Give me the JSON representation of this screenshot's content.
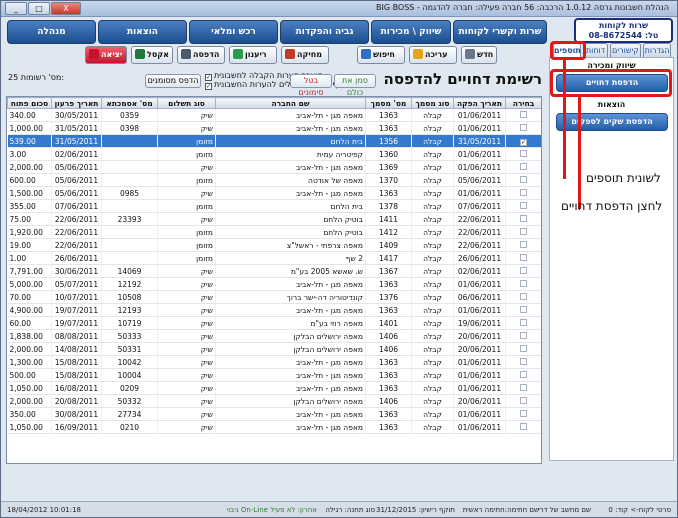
{
  "window": {
    "title": "BIG BOSS - הנהלת חשבונות גרסה 1.0.12 הרכבה: 56 חברה פעילה: חברה להדגמה"
  },
  "window_buttons": {
    "minimize": "_",
    "maximize": "□",
    "close": "X"
  },
  "nav": [
    "שרות וקשרי לקוחות",
    "שיווק \\ מכירות",
    "גביה והפקדות",
    "רכש ומלאי",
    "הוצאות",
    "מנהלה"
  ],
  "contact": {
    "line1": "שרות לקוחות",
    "line2": "טל: 08-8672544"
  },
  "toolbar": [
    {
      "label": "חדש",
      "color": "#6a7788"
    },
    {
      "label": "עריכה",
      "color": "#e4a51b"
    },
    {
      "label": "חיפוש",
      "color": "#2f6fc8"
    },
    {
      "label": "מחיקה",
      "color": "#c0392b"
    },
    {
      "label": "ריענון",
      "color": "#2a9d4a"
    },
    {
      "label": "הדפסה",
      "color": "#4a5b70"
    },
    {
      "label": "אקסל",
      "color": "#1f7a3d"
    },
    {
      "label": "יציאה",
      "color": "#c8122b"
    }
  ],
  "tabs": [
    "הגדרות",
    "קישורים",
    "דוחות",
    "תוספים"
  ],
  "page": {
    "title": "רשימת דחויים להדפסה",
    "records_label": "מס' רשומות:",
    "records_count": "25"
  },
  "options": {
    "opt1": "הועבר הערות הקבלה לחשבונית",
    "opt2": "הוסף שרותים פעילים להערות החשבונית"
  },
  "actions": {
    "print_selected": "הדפס מסומנים",
    "clear_marks": "בטל סימונים",
    "mark_all": "סמן את כולם"
  },
  "columns": [
    "בחירה",
    "תאריך הפקה",
    "סוג מסמך",
    "מס' מסמך",
    "שם החברה",
    "סוג תשלום",
    "מס' אסמכתא",
    "תאריך פרעון",
    "סכום פתוח"
  ],
  "rows": [
    {
      "date": "01/06/2011",
      "type": "קבלה",
      "num": "1363",
      "company": "מאפה מגן - תל-אביב",
      "pay": "שיק",
      "ref": "0359",
      "due": "30/05/2011",
      "amount": "340.00",
      "sel": false
    },
    {
      "date": "01/06/2011",
      "type": "קבלה",
      "num": "1363",
      "company": "מאפה מגן - תל-אביב",
      "pay": "שיק",
      "ref": "0398",
      "due": "31/05/2011",
      "amount": "1,000.00",
      "sel": false
    },
    {
      "date": "31/05/2011",
      "type": "קבלה",
      "num": "1356",
      "company": "בית הלחם",
      "pay": "מזומן",
      "ref": "",
      "due": "31/05/2011",
      "amount": "539.00",
      "sel": true
    },
    {
      "date": "01/06/2011",
      "type": "קבלה",
      "num": "1360",
      "company": "קפיטריה עמית",
      "pay": "מזומן",
      "ref": "",
      "due": "02/06/2011",
      "amount": "3.00",
      "sel": false
    },
    {
      "date": "01/06/2011",
      "type": "קבלה",
      "num": "1369",
      "company": "מאפה מגן - תל-אביב",
      "pay": "שיק",
      "ref": "",
      "due": "05/06/2011",
      "amount": "2,000.00",
      "sel": false
    },
    {
      "date": "05/06/2011",
      "type": "קבלה",
      "num": "1370",
      "company": "מאפה של אודטה",
      "pay": "מזומן",
      "ref": "",
      "due": "05/06/2011",
      "amount": "600.00",
      "sel": false
    },
    {
      "date": "01/06/2011",
      "type": "קבלה",
      "num": "1363",
      "company": "מאפה מגן - תל-אביב",
      "pay": "שיק",
      "ref": "0985",
      "due": "05/06/2011",
      "amount": "1,500.00",
      "sel": false
    },
    {
      "date": "07/06/2011",
      "type": "קבלה",
      "num": "1378",
      "company": "בית הלחם",
      "pay": "מזומן",
      "ref": "",
      "due": "07/06/2011",
      "amount": "355.00",
      "sel": false
    },
    {
      "date": "22/06/2011",
      "type": "קבלה",
      "num": "1411",
      "company": "בוטיק הלחם",
      "pay": "שיק",
      "ref": "23393",
      "due": "22/06/2011",
      "amount": "75.00",
      "sel": false
    },
    {
      "date": "22/06/2011",
      "type": "קבלה",
      "num": "1412",
      "company": "בוטיק הלחם",
      "pay": "מזומן",
      "ref": "",
      "due": "22/06/2011",
      "amount": "1,920.00",
      "sel": false
    },
    {
      "date": "22/06/2011",
      "type": "קבלה",
      "num": "1409",
      "company": "מאפה צרפתי - ראשל\"צ",
      "pay": "מזומן",
      "ref": "",
      "due": "22/06/2011",
      "amount": "19.00",
      "sel": false
    },
    {
      "date": "26/06/2011",
      "type": "קבלה",
      "num": "1417",
      "company": "2 שף",
      "pay": "מזומן",
      "ref": "",
      "due": "26/06/2011",
      "amount": "1.00",
      "sel": false
    },
    {
      "date": "02/06/2011",
      "type": "קבלה",
      "num": "1367",
      "company": "ש. שאשא 2005 בע\"מ",
      "pay": "שיק",
      "ref": "14069",
      "due": "30/06/2011",
      "amount": "7,791.00",
      "sel": false
    },
    {
      "date": "01/06/2011",
      "type": "קבלה",
      "num": "1363",
      "company": "מאפה מגן - תל-אביב",
      "pay": "שיק",
      "ref": "12192",
      "due": "05/07/2011",
      "amount": "5,000.00",
      "sel": false
    },
    {
      "date": "06/06/2011",
      "type": "קבלה",
      "num": "1376",
      "company": "קונדיטוריה דה-ישר ברוך",
      "pay": "שיק",
      "ref": "10508",
      "due": "10/07/2011",
      "amount": "70.00",
      "sel": false
    },
    {
      "date": "01/06/2011",
      "type": "קבלה",
      "num": "1363",
      "company": "מאפה מגן - תל-אביב",
      "pay": "שיק",
      "ref": "12193",
      "due": "19/07/2011",
      "amount": "4,900.00",
      "sel": false
    },
    {
      "date": "19/06/2011",
      "type": "קבלה",
      "num": "1401",
      "company": "מאפה רוזי בע\"מ",
      "pay": "שיק",
      "ref": "10719",
      "due": "19/07/2011",
      "amount": "60.00",
      "sel": false
    },
    {
      "date": "20/06/2011",
      "type": "קבלה",
      "num": "1406",
      "company": "מאפה ירושלים הבלקן",
      "pay": "שיק",
      "ref": "50333",
      "due": "08/08/2011",
      "amount": "1,838.00",
      "sel": false
    },
    {
      "date": "20/06/2011",
      "type": "קבלה",
      "num": "1406",
      "company": "מאפה ירושלים הבלקן",
      "pay": "שיק",
      "ref": "50331",
      "due": "14/08/2011",
      "amount": "2,000.00",
      "sel": false
    },
    {
      "date": "01/06/2011",
      "type": "קבלה",
      "num": "1363",
      "company": "מאפה מגן - תל-אביב",
      "pay": "שיק",
      "ref": "10042",
      "due": "15/08/2011",
      "amount": "1,300.00",
      "sel": false
    },
    {
      "date": "01/06/2011",
      "type": "קבלה",
      "num": "1363",
      "company": "מאפה מגן - תל-אביב",
      "pay": "שיק",
      "ref": "10004",
      "due": "15/08/2011",
      "amount": "500.00",
      "sel": false
    },
    {
      "date": "01/06/2011",
      "type": "קבלה",
      "num": "1363",
      "company": "מאפה מגן - תל-אביב",
      "pay": "שיק",
      "ref": "0209",
      "due": "16/08/2011",
      "amount": "1,050.00",
      "sel": false
    },
    {
      "date": "20/06/2011",
      "type": "קבלה",
      "num": "1406",
      "company": "מאפה ירושלים הבלקן",
      "pay": "שיק",
      "ref": "50332",
      "due": "20/08/2011",
      "amount": "2,000.00",
      "sel": false
    },
    {
      "date": "01/06/2011",
      "type": "קבלה",
      "num": "1363",
      "company": "מאפה מגן - תל-אביב",
      "pay": "שיק",
      "ref": "27734",
      "due": "30/08/2011",
      "amount": "350.00",
      "sel": false
    },
    {
      "date": "01/06/2011",
      "type": "קבלה",
      "num": "1363",
      "company": "מאפה מגן - תל-אביב",
      "pay": "שיק",
      "ref": "0210",
      "due": "16/09/2011",
      "amount": "1,050.00",
      "sel": false
    }
  ],
  "sidebar": {
    "section1": "שיווק ומכירה",
    "btn1": "הדפסת דחויים",
    "section2": "הוצאות",
    "btn2": "הדפסת שקים לספקים"
  },
  "annotations": {
    "tab_note": "לשונית תוספים",
    "btn_note": "לחצן הדפסת דחויים"
  },
  "status": {
    "s1": "סרטי לקוח-> קוד: 0",
    "s2": "שם מחשב של דרי",
    "s3": "שם חתימה:חתימה ראשית",
    "s4": "תוקף רישיון: 31/12/2015",
    "s5": "סוג תחנה: רגילה",
    "s6": "גיבוי On-Line אחרון: לא פעיל",
    "s7": "18/04/2012 10:01:18"
  },
  "colors": {
    "accent": "#245ea9",
    "selected_row": "#3478d0",
    "highlight": "#e01818"
  }
}
